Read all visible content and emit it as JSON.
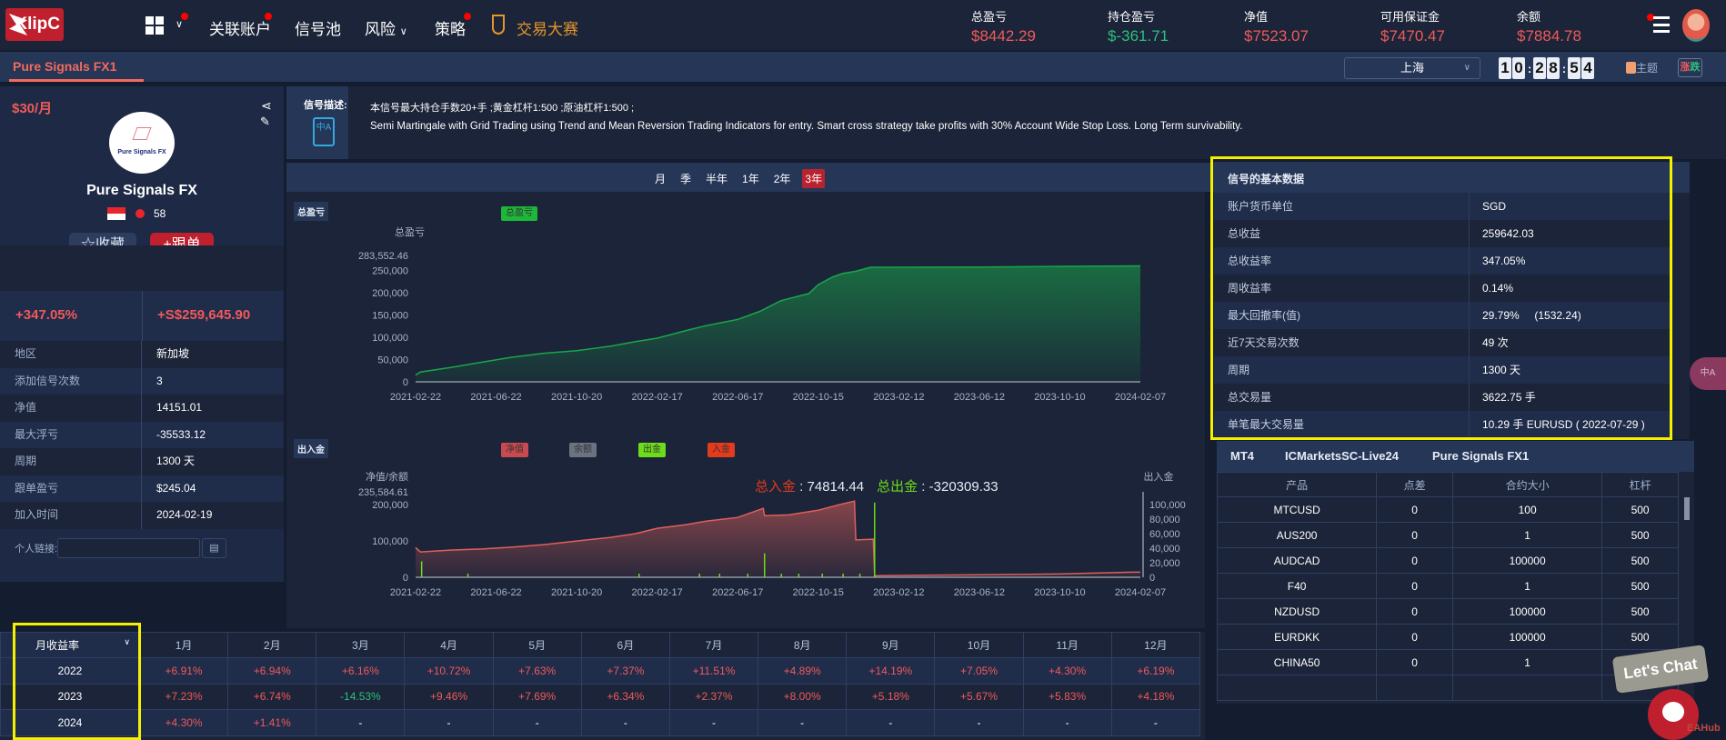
{
  "nav": {
    "brand": "KlipC",
    "items": [
      "关联账户",
      "信号池",
      "风险",
      "策略"
    ],
    "contest": "交易大赛"
  },
  "account_stats": [
    {
      "label": "总盈亏",
      "value": "$8442.29",
      "color": "red"
    },
    {
      "label": "持仓盈亏",
      "value": "$-361.71",
      "color": "green"
    },
    {
      "label": "净值",
      "value": "$7523.07",
      "color": "red"
    },
    {
      "label": "可用保证金",
      "value": "$7470.47",
      "color": "red"
    },
    {
      "label": "余额",
      "value": "$7884.78",
      "color": "red"
    }
  ],
  "tab": {
    "active": "Pure Signals FX1"
  },
  "toolbar": {
    "timezone": "上海",
    "clock": [
      "1",
      "0",
      "2",
      "8",
      "5",
      "4"
    ],
    "theme": "主题",
    "updown_a": "涨",
    "updown_b": "跌"
  },
  "profile": {
    "price": "$30/月",
    "logo_text": "Pure Signals FX",
    "name": "Pure Signals FX",
    "fire_count": "58",
    "favorite": "收藏",
    "follow": "跟单",
    "return_pct": "+347.05%",
    "return_amt": "+S$259,645.90",
    "rows": [
      {
        "k": "地区",
        "v": "新加坡"
      },
      {
        "k": "添加信号次数",
        "v": "3"
      },
      {
        "k": "净值",
        "v": "14151.01"
      },
      {
        "k": "最大浮亏",
        "v": "-35533.12"
      },
      {
        "k": "周期",
        "v": "1300 天"
      },
      {
        "k": "跟单盈亏",
        "v": "$245.04"
      },
      {
        "k": "加入时间",
        "v": "2024-02-19"
      }
    ],
    "link_label": "个人链接:"
  },
  "description": {
    "label": "信号描述:",
    "line1": "本信号最大持仓手数20+手 ;黄金杠杆1:500 ;原油杠杆1:500 ;",
    "line2": "Semi Martingale with Grid Trading using Trend and Mean Reversion Trading Indicators for entry. Smart cross strategy take profits with 30% Account Wide Stop Loss. Long Term survivability."
  },
  "periods": {
    "items": [
      "月",
      "季",
      "半年",
      "1年",
      "2年",
      "3年"
    ],
    "active": "3年"
  },
  "chart_data": [
    {
      "type": "area",
      "section": "总盈亏",
      "title": "总盈亏",
      "legend": [
        "总盈亏"
      ],
      "ylabel": "总盈亏",
      "ylim": [
        0,
        283552.46
      ],
      "y_top_label": "283,552.46",
      "yticks": [
        "0",
        "50,000",
        "100,000",
        "150,000",
        "200,000",
        "250,000"
      ],
      "ytick_values": [
        0,
        50000,
        100000,
        150000,
        200000,
        250000
      ],
      "xticks": [
        "2021-02-22",
        "2021-06-22",
        "2021-10-20",
        "2022-02-17",
        "2022-06-17",
        "2022-10-15",
        "2023-02-12",
        "2023-06-12",
        "2023-10-10",
        "2024-02-07"
      ],
      "x": [
        "2021-02-22",
        "2021-03-01",
        "2021-04-15",
        "2021-06-01",
        "2021-07-15",
        "2021-09-01",
        "2021-10-20",
        "2021-12-10",
        "2022-01-15",
        "2022-02-17",
        "2022-04-01",
        "2022-05-01",
        "2022-06-17",
        "2022-07-20",
        "2022-08-20",
        "2022-10-01",
        "2022-10-15",
        "2022-11-05",
        "2022-11-20",
        "2022-12-10",
        "2023-01-01",
        "2023-02-12",
        "2023-06-12",
        "2023-10-10",
        "2024-02-07"
      ],
      "values": [
        15000,
        22000,
        32000,
        44000,
        55000,
        64000,
        70000,
        80000,
        90000,
        98000,
        115000,
        126000,
        140000,
        158000,
        182000,
        198000,
        218000,
        235000,
        243000,
        248000,
        257000,
        257000,
        257500,
        259000,
        260000
      ]
    },
    {
      "type": "area+bar",
      "section": "出入金",
      "title": "出入金",
      "legend": [
        "净值",
        "余额",
        "出金",
        "入金"
      ],
      "ylabel_left": "净值/余额",
      "ylabel_right": "出入金",
      "ylim": [
        0,
        235584.61
      ],
      "y_top_label": "235,584.61",
      "yticks": [
        "0",
        "100,000",
        "200,000"
      ],
      "ytick_values": [
        0,
        100000,
        200000
      ],
      "y2ticks": [
        "0",
        "20,000",
        "40,000",
        "60,000",
        "80,000",
        "100,000"
      ],
      "y2tick_values": [
        0,
        20000,
        40000,
        60000,
        80000,
        100000
      ],
      "total_in_label": "总入金",
      "total_in": "74814.44",
      "total_out_label": "总出金",
      "total_out": "-320309.33",
      "x": [
        "2021-02-22",
        "2021-03-01",
        "2021-04-15",
        "2021-06-01",
        "2021-07-15",
        "2021-09-01",
        "2021-10-20",
        "2021-12-10",
        "2022-01-15",
        "2022-02-17",
        "2022-04-01",
        "2022-05-01",
        "2022-06-17",
        "2022-07-25",
        "2022-07-27",
        "2022-09-01",
        "2022-10-15",
        "2022-11-15",
        "2022-12-08",
        "2022-12-10",
        "2023-01-05",
        "2023-01-07",
        "2023-02-12",
        "2023-06-12",
        "2023-10-10",
        "2024-01-25",
        "2024-02-07"
      ],
      "equity": [
        82000,
        70000,
        75000,
        78000,
        83000,
        90000,
        100000,
        110000,
        120000,
        135000,
        145000,
        155000,
        165000,
        190000,
        170000,
        172000,
        185000,
        200000,
        210000,
        103000,
        105000,
        4000,
        5000,
        7000,
        9000,
        14000,
        14000
      ],
      "flows": [
        {
          "date": "2021-03-02",
          "amount": 22000,
          "kind": "出金"
        },
        {
          "date": "2021-05-10",
          "amount": 5000,
          "kind": "出金"
        },
        {
          "date": "2022-01-20",
          "amount": 5000,
          "kind": "出金"
        },
        {
          "date": "2022-04-20",
          "amount": 5000,
          "kind": "出金"
        },
        {
          "date": "2022-05-20",
          "amount": 5000,
          "kind": "出金"
        },
        {
          "date": "2022-07-01",
          "amount": 5000,
          "kind": "出金"
        },
        {
          "date": "2022-07-26",
          "amount": 33000,
          "kind": "出金"
        },
        {
          "date": "2022-08-20",
          "amount": 5000,
          "kind": "出金"
        },
        {
          "date": "2022-09-15",
          "amount": 5000,
          "kind": "出金"
        },
        {
          "date": "2022-10-20",
          "amount": 5000,
          "kind": "出金"
        },
        {
          "date": "2022-11-20",
          "amount": 5000,
          "kind": "出金"
        },
        {
          "date": "2022-12-15",
          "amount": 5000,
          "kind": "出金"
        },
        {
          "date": "2023-01-06",
          "amount": 103000,
          "kind": "出金"
        }
      ],
      "xticks": [
        "2021-02-22",
        "2021-06-22",
        "2021-10-20",
        "2022-02-17",
        "2022-06-17",
        "2022-10-15",
        "2023-02-12",
        "2023-06-12",
        "2023-10-10",
        "2024-02-07"
      ]
    }
  ],
  "colors": {
    "green_line": "#1aa64a",
    "equity": "#e0605c",
    "out": "#6ddc1a",
    "in": "#e33b1c",
    "balance": "#6b7280"
  },
  "basic": {
    "title": "信号的基本数据",
    "rows": [
      {
        "k": "账户货币单位",
        "v": "SGD"
      },
      {
        "k": "总收益",
        "v": "259642.03"
      },
      {
        "k": "总收益率",
        "v": "347.05%"
      },
      {
        "k": "周收益率",
        "v": "0.14%"
      },
      {
        "k": "最大回撤率(值)",
        "v": "29.79%     (1532.24)"
      },
      {
        "k": "近7天交易次数",
        "v": "49 次"
      },
      {
        "k": "周期",
        "v": "1300 天"
      },
      {
        "k": "总交易量",
        "v": "3622.75 手"
      },
      {
        "k": "单笔最大交易量",
        "v": "10.29 手 EURUSD ( 2022-07-29 )"
      }
    ]
  },
  "account": {
    "platform": "MT4",
    "server": "ICMarketsSC-Live24",
    "name": "Pure Signals FX1",
    "headers": [
      "产品",
      "点差",
      "合约大小",
      "杠杆"
    ],
    "rows": [
      [
        "MTCUSD",
        "0",
        "100",
        "500"
      ],
      [
        "AUS200",
        "0",
        "1",
        "500"
      ],
      [
        "AUDCAD",
        "0",
        "100000",
        "500"
      ],
      [
        "F40",
        "0",
        "1",
        "500"
      ],
      [
        "NZDUSD",
        "0",
        "100000",
        "500"
      ],
      [
        "EURDKK",
        "0",
        "100000",
        "500"
      ],
      [
        "CHINA50",
        "0",
        "1",
        "500"
      ]
    ]
  },
  "monthly": {
    "selector": "月收益率",
    "months": [
      "1月",
      "2月",
      "3月",
      "4月",
      "5月",
      "6月",
      "7月",
      "8月",
      "9月",
      "10月",
      "11月",
      "12月"
    ],
    "rows": [
      {
        "year": "2022",
        "values": [
          "+6.91%",
          "+6.94%",
          "+6.16%",
          "+10.72%",
          "+7.63%",
          "+7.37%",
          "+11.51%",
          "+4.89%",
          "+14.19%",
          "+7.05%",
          "+4.30%",
          "+6.19%"
        ]
      },
      {
        "year": "2023",
        "values": [
          "+7.23%",
          "+6.74%",
          "-14.53%",
          "+9.46%",
          "+7.69%",
          "+6.34%",
          "+2.37%",
          "+8.00%",
          "+5.18%",
          "+5.67%",
          "+5.83%",
          "+4.18%"
        ]
      },
      {
        "year": "2024",
        "values": [
          "+4.30%",
          "+1.41%",
          "-",
          "-",
          "-",
          "-",
          "-",
          "-",
          "-",
          "-",
          "-",
          "-"
        ]
      }
    ]
  },
  "chat": {
    "bubble": "Let's Chat",
    "brand": "EAHub"
  },
  "translate_badge": "中A"
}
